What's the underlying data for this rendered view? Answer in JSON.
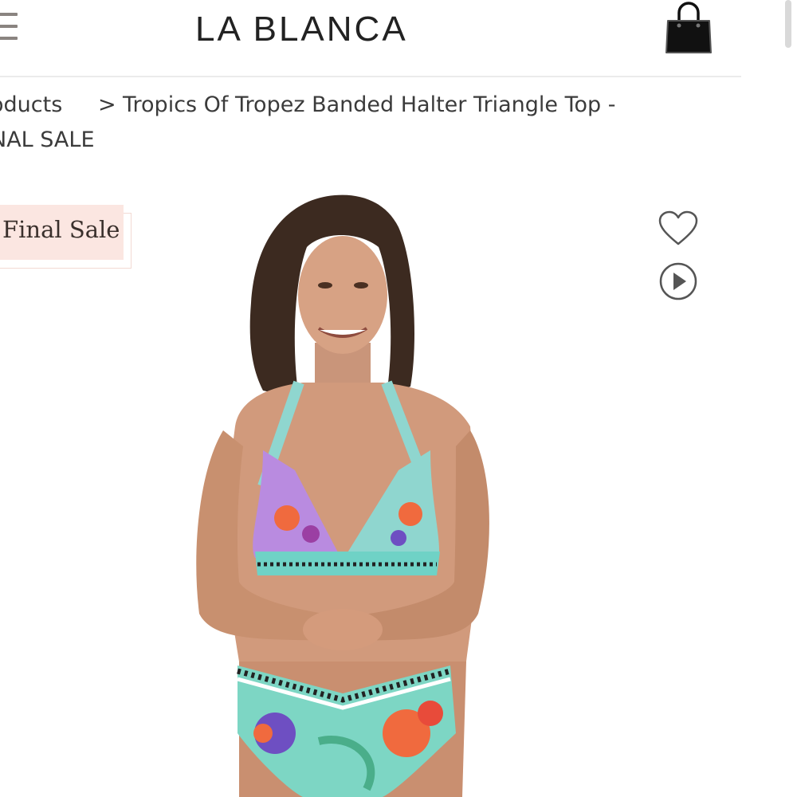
{
  "header": {
    "brand": "LA BLANCA",
    "menu_icon": "hamburger-menu-icon",
    "cart_icon": "shopping-bag-icon"
  },
  "breadcrumb": {
    "products": "oducts",
    "separator": ">",
    "current_line1": "Tropics Of Tropez Banded Halter Triangle Top -",
    "current_line2": "NAL SALE"
  },
  "badge": {
    "label": "Final Sale"
  },
  "actions": {
    "wishlist_icon": "heart-icon",
    "video_icon": "play-icon"
  },
  "colors": {
    "badge_bg": "#fbe6e1",
    "text": "#3b3b3b",
    "icon": "#555555"
  }
}
